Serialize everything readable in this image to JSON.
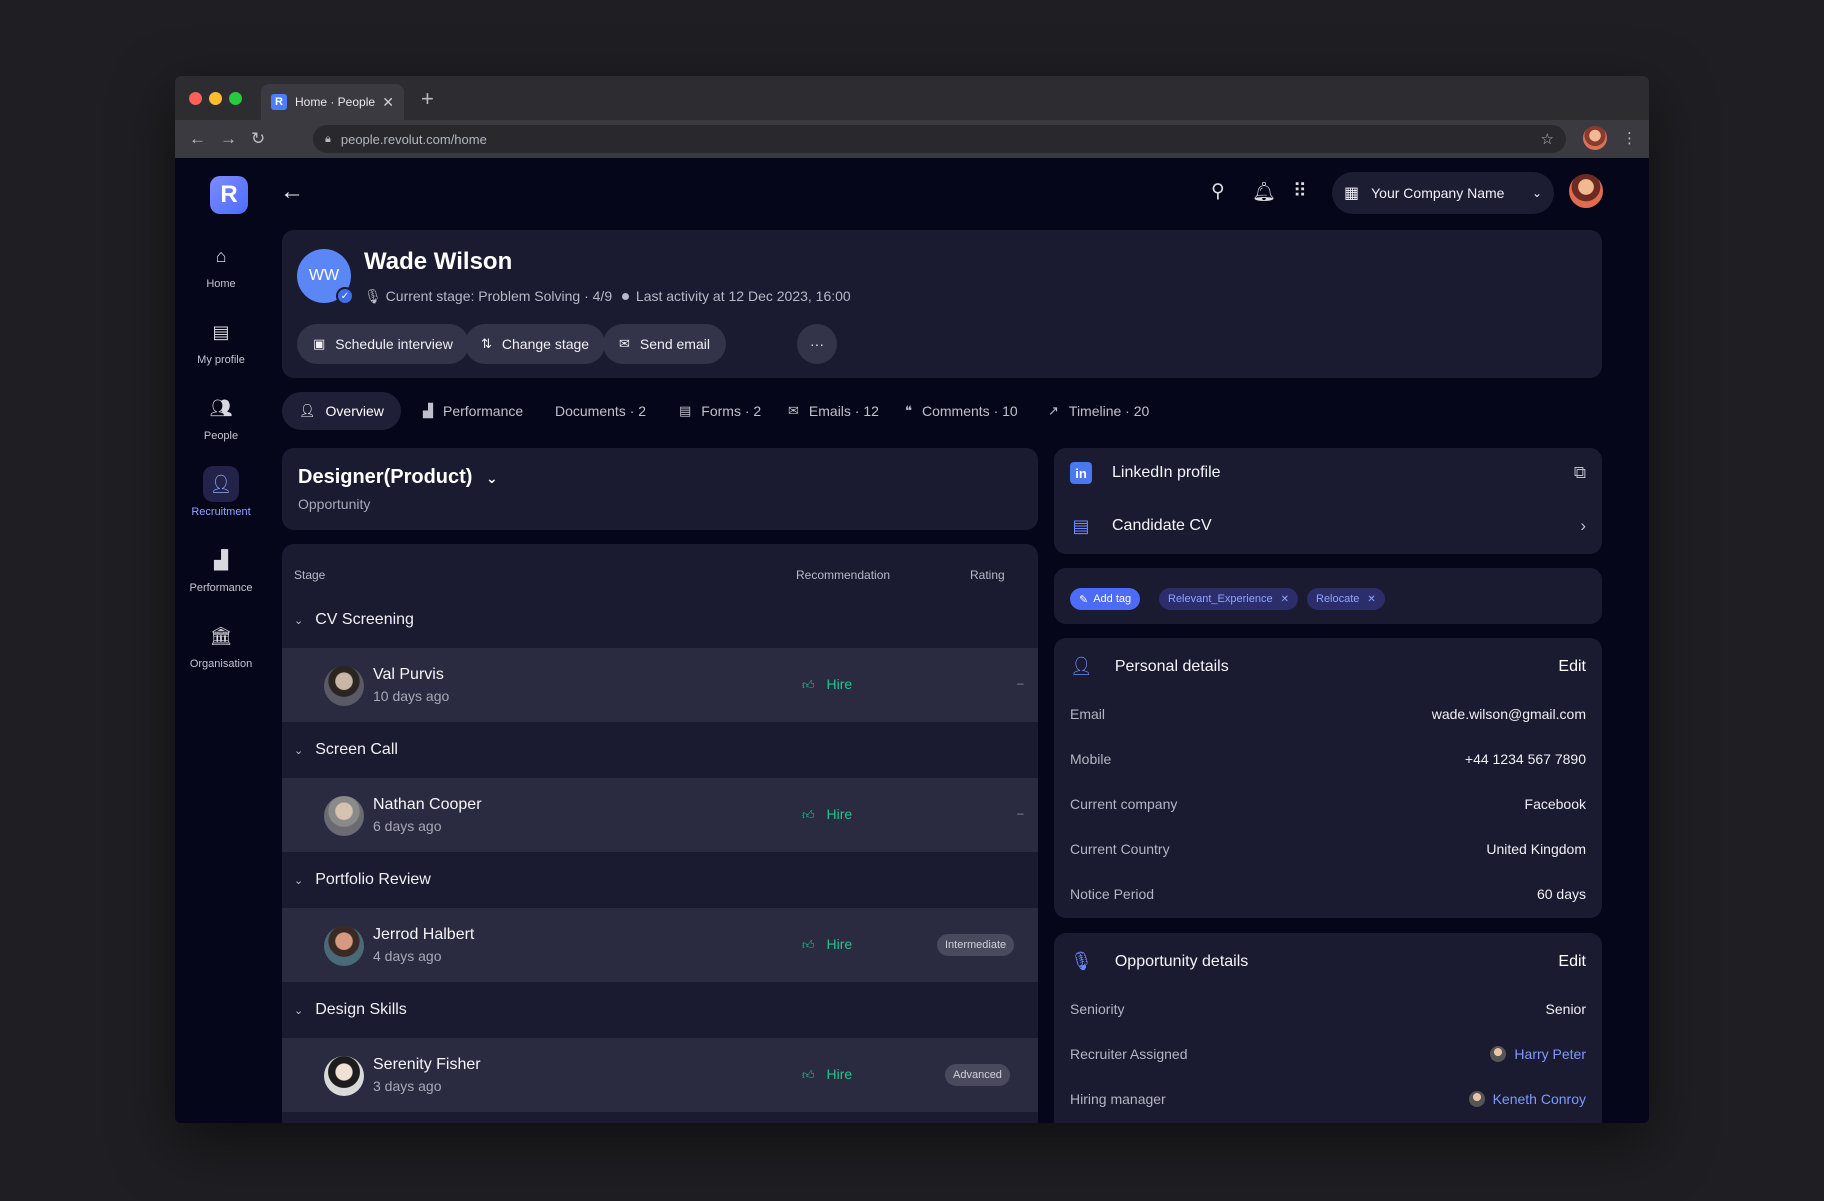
{
  "browser": {
    "tab_title": "Home · People",
    "favicon_letter": "R",
    "url": "people.revolut.com/home"
  },
  "sidebar": {
    "logo_letter": "R",
    "items": [
      {
        "label": "Home",
        "icon": "home-icon"
      },
      {
        "label": "My profile",
        "icon": "id-card-icon"
      },
      {
        "label": "People",
        "icon": "people-icon"
      },
      {
        "label": "Recruitment",
        "icon": "add-user-icon",
        "active": true
      },
      {
        "label": "Performance",
        "icon": "chart-icon"
      },
      {
        "label": "Organisation",
        "icon": "bank-icon"
      }
    ]
  },
  "topbar": {
    "company_name": "Your Company Name"
  },
  "candidate": {
    "initials": "WW",
    "name": "Wade Wilson",
    "stage_text": "Current stage: Problem Solving · 4/9",
    "activity_text": "Last activity at 12 Dec 2023, 16:00",
    "actions": {
      "schedule": "Schedule interview",
      "change_stage": "Change stage",
      "send_email": "Send email",
      "more": "···"
    }
  },
  "tabs": [
    {
      "label": "Overview",
      "icon": "person-icon",
      "active": true
    },
    {
      "label": "Performance",
      "icon": "chart-icon"
    },
    {
      "label": "Documents · 2",
      "icon": ""
    },
    {
      "label": "Forms · 2",
      "icon": "form-icon"
    },
    {
      "label": "Emails · 12",
      "icon": "mail-icon"
    },
    {
      "label": "Comments · 10",
      "icon": "comment-icon"
    },
    {
      "label": "Timeline · 20",
      "icon": "timeline-icon"
    }
  ],
  "role": {
    "title": "Designer(Product)",
    "subtitle": "Opportunity"
  },
  "stages_table": {
    "headers": {
      "stage": "Stage",
      "recommendation": "Recommendation",
      "rating": "Rating"
    },
    "groups": [
      {
        "name": "CV Screening",
        "person": "Val Purvis",
        "when": "10 days ago",
        "recommendation": "Hire",
        "rating": "–"
      },
      {
        "name": "Screen Call",
        "person": "Nathan Cooper",
        "when": "6 days ago",
        "recommendation": "Hire",
        "rating": "–"
      },
      {
        "name": "Portfolio Review",
        "person": "Jerrod Halbert",
        "when": "4 days ago",
        "recommendation": "Hire",
        "rating": "Intermediate"
      },
      {
        "name": "Design Skills",
        "person": "Serenity Fisher",
        "when": "3 days ago",
        "recommendation": "Hire",
        "rating": "Advanced"
      }
    ]
  },
  "links": {
    "linkedin": "LinkedIn profile",
    "cv": "Candidate CV"
  },
  "tags": {
    "add_label": "Add tag",
    "items": [
      "Relevant_Experience",
      "Relocate"
    ]
  },
  "personal_details": {
    "title": "Personal details",
    "edit": "Edit",
    "rows": [
      {
        "key": "Email",
        "value": "wade.wilson@gmail.com"
      },
      {
        "key": "Mobile",
        "value": "+44 1234 567 7890"
      },
      {
        "key": "Current company",
        "value": "Facebook"
      },
      {
        "key": "Current Country",
        "value": "United Kingdom"
      },
      {
        "key": "Notice Period",
        "value": "60 days"
      }
    ]
  },
  "opportunity_details": {
    "title": "Opportunity details",
    "edit": "Edit",
    "rows": [
      {
        "key": "Seniority",
        "value": "Senior"
      },
      {
        "key": "Recruiter Assigned",
        "value": "Harry Peter"
      },
      {
        "key": "Hiring manager",
        "value": "Keneth Conroy"
      }
    ]
  },
  "colors": {
    "accent": "#4d6bfe",
    "hire": "#21c58b",
    "background": "#06061a",
    "card": "#1a1a30"
  }
}
